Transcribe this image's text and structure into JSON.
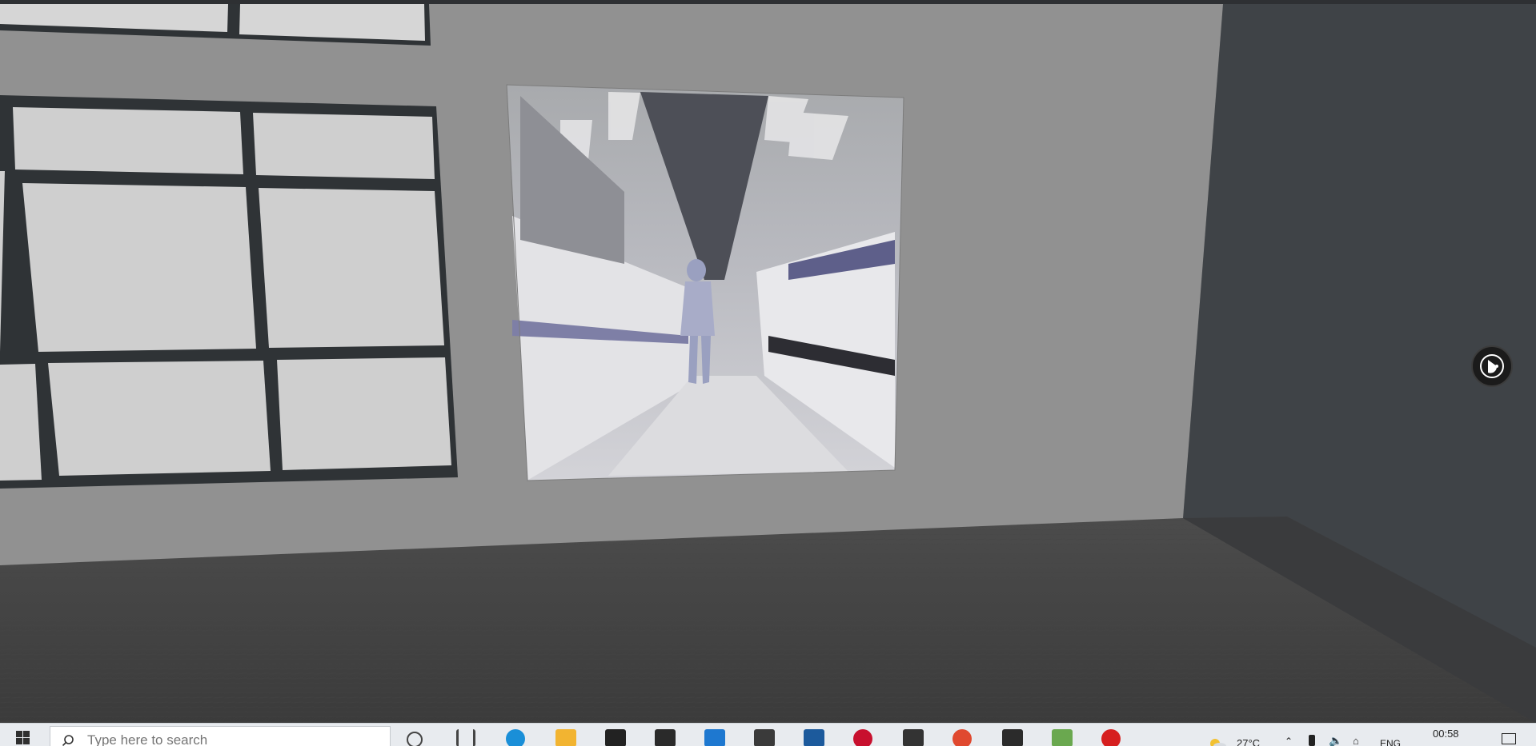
{
  "search": {
    "placeholder": "Type here to search"
  },
  "tray": {
    "weather": "27°C",
    "language": "ENG",
    "time": "00:58"
  },
  "taskbar_apps": [
    {
      "name": "cortana-icon",
      "color": "#444444"
    },
    {
      "name": "task-view-icon",
      "color": "#444444"
    },
    {
      "name": "edge-icon",
      "color": "#1a8fd8"
    },
    {
      "name": "file-explorer-icon",
      "color": "#f2b431"
    },
    {
      "name": "dropbox-icon",
      "color": "#222222"
    },
    {
      "name": "notion-icon",
      "color": "#2a2a2a"
    },
    {
      "name": "mail-icon",
      "color": "#1e78d0"
    },
    {
      "name": "sticky-app-icon",
      "color": "#3a3a3a"
    },
    {
      "name": "virtualbox-icon",
      "color": "#1c5a9c"
    },
    {
      "name": "red-app-icon",
      "color": "#c8102e"
    },
    {
      "name": "store-icon",
      "color": "#333333"
    },
    {
      "name": "chrome-icon",
      "color": "#e0492f"
    },
    {
      "name": "gc-app-icon",
      "color": "#2b2b2b"
    },
    {
      "name": "kite-icon",
      "color": "#6aa84f"
    },
    {
      "name": "record-icon",
      "color": "#d61f1f"
    }
  ]
}
